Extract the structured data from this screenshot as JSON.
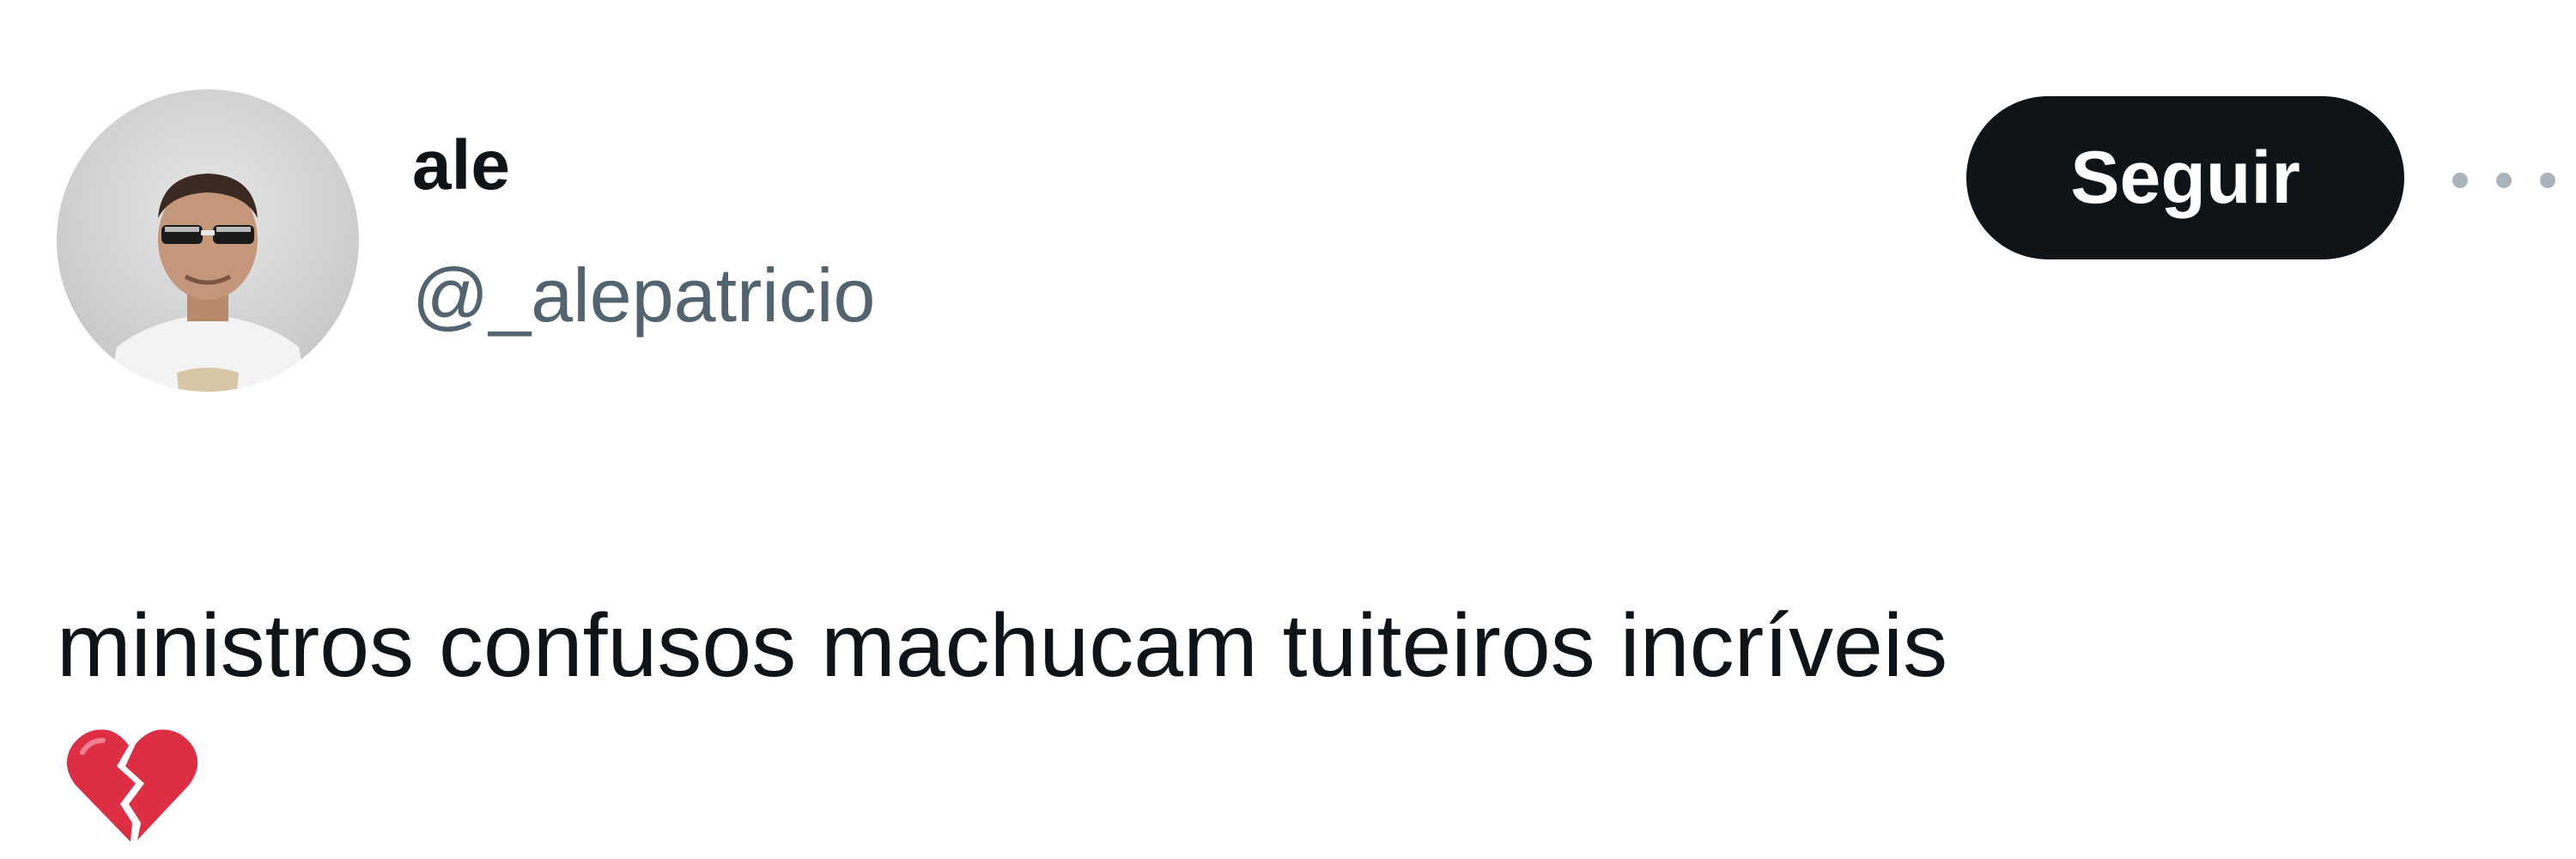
{
  "tweet": {
    "author": {
      "display_name": "ale",
      "handle": "@_alepatricio",
      "avatar_icon": "profile-photo"
    },
    "follow_button_label": "Seguir",
    "more_icon": "ellipsis-icon",
    "text": "ministros confusos machucam tuiteiros incríveis",
    "emoji": "broken-heart"
  },
  "colors": {
    "text_primary": "#0f1419",
    "text_secondary": "#536471",
    "button_bg": "#0f1419",
    "button_text": "#ffffff",
    "emoji_red": "#dd2e44"
  }
}
